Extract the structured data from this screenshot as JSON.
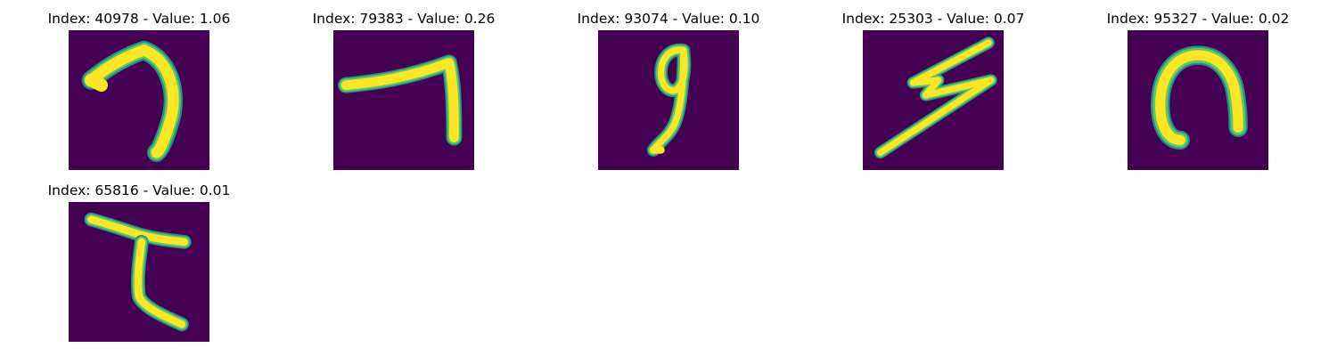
{
  "colors": {
    "background": "#440154",
    "stroke_outer": "#21918c",
    "stroke_mid": "#5ec962",
    "stroke_core": "#fde725"
  },
  "panels": [
    {
      "index": "40978",
      "value": "1.06",
      "title": "Index: 40978 - Value: 1.06"
    },
    {
      "index": "79383",
      "value": "0.26",
      "title": "Index: 79383 - Value: 0.26"
    },
    {
      "index": "93074",
      "value": "0.10",
      "title": "Index: 93074 - Value: 0.10"
    },
    {
      "index": "25303",
      "value": "0.07",
      "title": "Index: 25303 - Value: 0.07"
    },
    {
      "index": "95327",
      "value": "0.02",
      "title": "Index: 95327 - Value: 0.02"
    },
    {
      "index": "65816",
      "value": "0.01",
      "title": "Index: 65816 - Value: 0.01"
    }
  ]
}
